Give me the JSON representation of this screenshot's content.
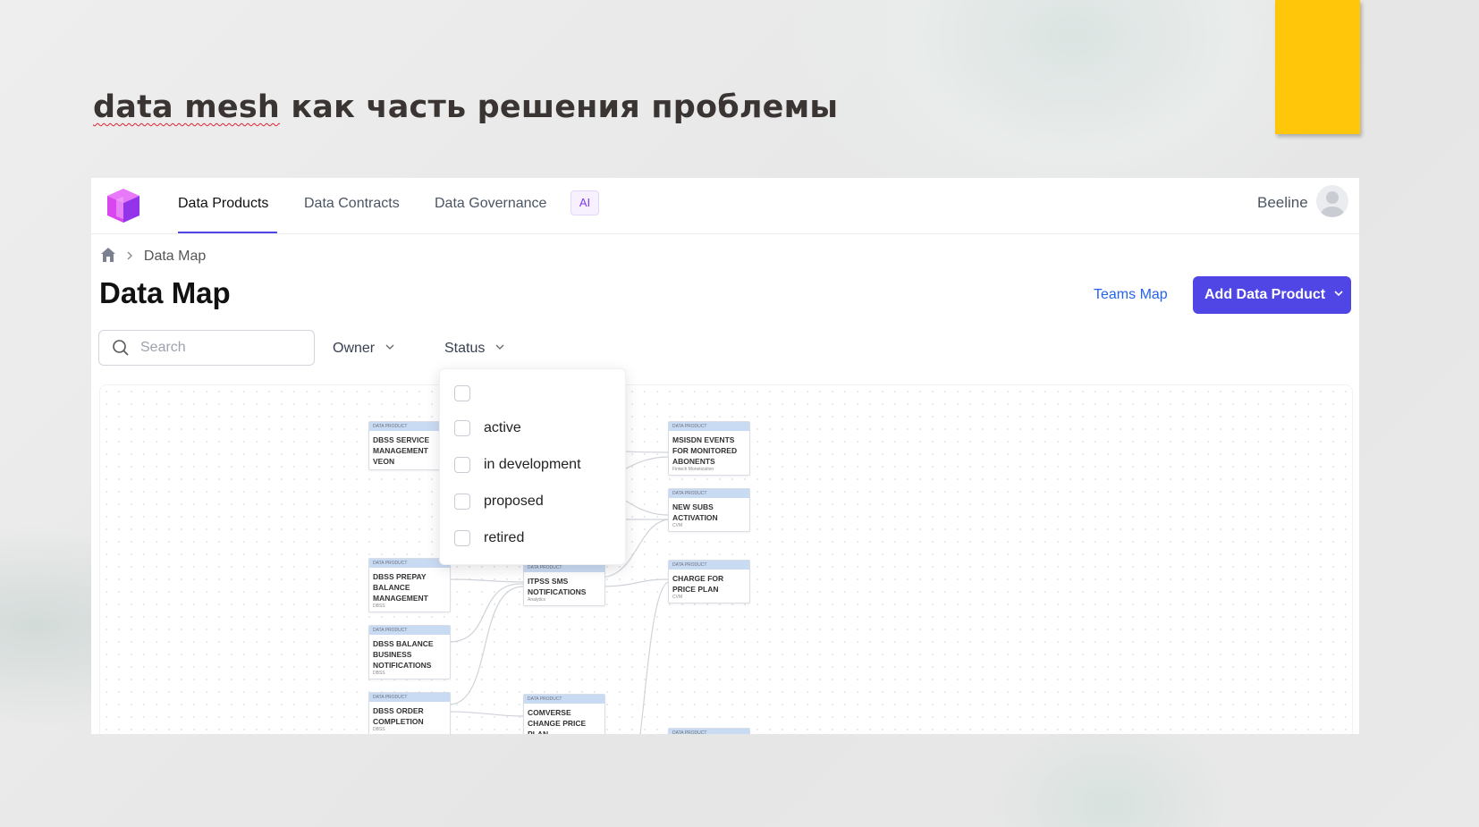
{
  "slide": {
    "title_part1": "data mesh",
    "title_part2": " как часть решения проблемы"
  },
  "colors": {
    "accent": "#4f46e5",
    "slide_yellow": "#ffc60a",
    "link": "#2563eb"
  },
  "nav": {
    "items": [
      {
        "label": "Data Products",
        "active": true
      },
      {
        "label": "Data Contracts",
        "active": false
      },
      {
        "label": "Data Governance",
        "active": false
      }
    ],
    "ai_badge": "AI",
    "org": "Beeline"
  },
  "breadcrumb": {
    "icon": "home-icon",
    "current": "Data Map"
  },
  "page": {
    "title": "Data Map",
    "teams_link": "Teams Map",
    "add_button": "Add Data Product"
  },
  "filters": {
    "search_placeholder": "Search",
    "owner_label": "Owner",
    "status_label": "Status"
  },
  "status_dropdown": {
    "options": [
      "",
      "active",
      "in development",
      "proposed",
      "retired"
    ]
  },
  "map_nodes": [
    {
      "kind": "DATA PRODUCT",
      "title": "DBSS SERVICE MANAGEMENT VEON",
      "sub": ""
    },
    {
      "kind": "DATA PRODUCT",
      "title": "MSISDN EVENTS FOR MONITORED ABONENTS",
      "sub": "Fintech Monetization"
    },
    {
      "kind": "DATA PRODUCT",
      "title": "NEW SUBS ACTIVATION",
      "sub": "CVM"
    },
    {
      "kind": "DATA PRODUCT",
      "title": "DBSS PREPAY BALANCE MANAGEMENT",
      "sub": "DBSS"
    },
    {
      "kind": "DATA PRODUCT",
      "title": "ITPSS SMS NOTIFICATIONS",
      "sub": "Analytics"
    },
    {
      "kind": "DATA PRODUCT",
      "title": "CHARGE FOR PRICE PLAN",
      "sub": "CVM"
    },
    {
      "kind": "DATA PRODUCT",
      "title": "DBSS BALANCE BUSINESS NOTIFICATIONS",
      "sub": "DBSS"
    },
    {
      "kind": "DATA PRODUCT",
      "title": "DBSS ORDER COMPLETION",
      "sub": "DBSS"
    },
    {
      "kind": "DATA PRODUCT",
      "title": "COMVERSE CHANGE PRICE PLAN",
      "sub": ""
    },
    {
      "kind": "DATA PRODUCT",
      "title": "",
      "sub": ""
    }
  ]
}
